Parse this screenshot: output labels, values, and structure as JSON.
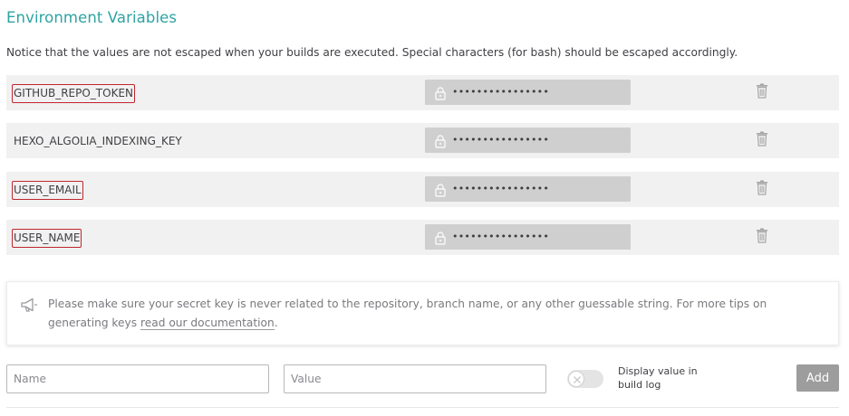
{
  "section": {
    "title": "Environment Variables",
    "notice": "Notice that the values are not escaped when your builds are executed. Special characters (for bash) should be escaped accordingly."
  },
  "env_vars": [
    {
      "name": "GITHUB_REPO_TOKEN",
      "value": "••••••••••••••••",
      "highlighted": true
    },
    {
      "name": "HEXO_ALGOLIA_INDEXING_KEY",
      "value": "••••••••••••••••",
      "highlighted": false
    },
    {
      "name": "USER_EMAIL",
      "value": "••••••••••••••••",
      "highlighted": true
    },
    {
      "name": "USER_NAME",
      "value": "••••••••••••••••",
      "highlighted": true
    }
  ],
  "tip": {
    "text": "Please make sure your secret key is never related to the repository, branch name, or any other guessable string. For more tips on generating keys ",
    "link_text": "read our documentation",
    "suffix": "."
  },
  "form": {
    "name_placeholder": "Name",
    "value_placeholder": "Value",
    "toggle_label": "Display value in build log",
    "add_label": "Add"
  },
  "colors": {
    "accent_title": "#2fa3a3",
    "highlight_border": "#c0262d",
    "row_background": "#f1f1f1",
    "masked_field": "#cfcfcf",
    "add_button": "#9d9d9d"
  },
  "icons": {
    "lock": "lock-icon",
    "delete": "trash-icon",
    "tip": "megaphone-icon",
    "toggle_off": "close-icon"
  }
}
